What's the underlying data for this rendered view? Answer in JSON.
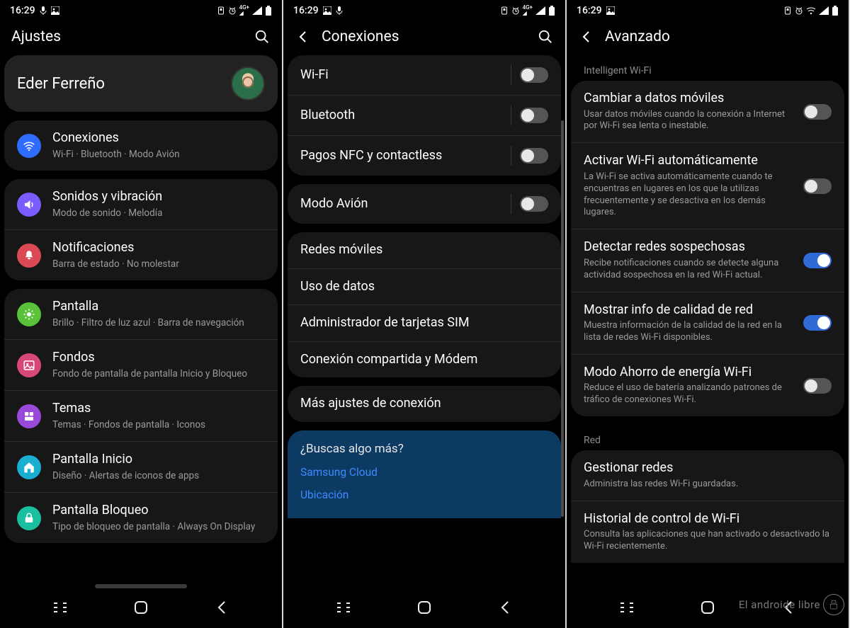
{
  "status": {
    "time": "16:29",
    "icons_left": [
      "mic",
      "image"
    ],
    "icons_right": [
      "dnd",
      "alarm",
      "4g",
      "signal",
      "battery"
    ]
  },
  "screen1": {
    "title": "Ajustes",
    "profile_name": "Eder Ferreño",
    "groups": [
      {
        "rows": [
          {
            "icon": "wifi",
            "color": "ic-blue",
            "title": "Conexiones",
            "sub": "Wi-Fi  ·  Bluetooth  ·  Modo Avión"
          }
        ]
      },
      {
        "rows": [
          {
            "icon": "sound",
            "color": "ic-purple",
            "title": "Sonidos y vibración",
            "sub": "Modo de sonido  ·  Melodía"
          },
          {
            "icon": "bell",
            "color": "ic-red",
            "title": "Notificaciones",
            "sub": "Barra de estado  ·  No molestar"
          }
        ]
      },
      {
        "rows": [
          {
            "icon": "sun",
            "color": "ic-green",
            "title": "Pantalla",
            "sub": "Brillo  ·  Filtro de luz azul  ·  Barra de navegación"
          },
          {
            "icon": "image",
            "color": "ic-pink",
            "title": "Fondos",
            "sub": "Fondo de pantalla de pantalla Inicio y Bloqueo"
          },
          {
            "icon": "palette",
            "color": "ic-violet",
            "title": "Temas",
            "sub": "Temas  ·  Fondos de pantalla  ·  Iconos"
          },
          {
            "icon": "home",
            "color": "ic-teal",
            "title": "Pantalla Inicio",
            "sub": "Diseño  ·  Alertas de iconos de apps"
          },
          {
            "icon": "lock",
            "color": "ic-teal2",
            "title": "Pantalla Bloqueo",
            "sub": "Tipo de bloqueo de pantalla  ·  Always On Display"
          }
        ]
      }
    ]
  },
  "screen2": {
    "title": "Conexiones",
    "group1": [
      {
        "title": "Wi-Fi",
        "toggle": false
      },
      {
        "title": "Bluetooth",
        "toggle": false
      },
      {
        "title": "Pagos NFC y contactless",
        "toggle": false
      }
    ],
    "group2": [
      {
        "title": "Modo Avión",
        "toggle": false
      }
    ],
    "group3": [
      {
        "title": "Redes móviles"
      },
      {
        "title": "Uso de datos"
      },
      {
        "title": "Administrador de tarjetas SIM"
      },
      {
        "title": "Conexión compartida y Módem"
      }
    ],
    "group4": [
      {
        "title": "Más ajustes de conexión"
      }
    ],
    "suggest": {
      "question": "¿Buscas algo más?",
      "links": [
        "Samsung Cloud",
        "Ubicación"
      ]
    }
  },
  "screen3": {
    "title": "Avanzado",
    "section1_header": "Intelligent Wi-Fi",
    "section1": [
      {
        "title": "Cambiar a datos móviles",
        "sub": "Usar datos móviles cuando la conexión a Internet por Wi-Fi sea lenta o inestable.",
        "toggle": false
      },
      {
        "title": "Activar Wi-Fi automáticamente",
        "sub": "La Wi-Fi se activa automáticamente cuando te encuentras en lugares en los que la utilizas frecuentemente y se desactiva en los demás lugares.",
        "toggle": false
      },
      {
        "title": "Detectar redes sospechosas",
        "sub": "Recibe notificaciones cuando se detecte alguna actividad sospechosa en la red Wi-Fi actual.",
        "toggle": true
      },
      {
        "title": "Mostrar info de calidad de red",
        "sub": "Muestra información de la calidad de la red en la lista de redes Wi-Fi disponibles.",
        "toggle": true
      },
      {
        "title": "Modo Ahorro de energía Wi-Fi",
        "sub": "Reduce el uso de batería analizando patrones de tráfico de conexiones Wi-Fi.",
        "toggle": false
      }
    ],
    "section2_header": "Red",
    "section2": [
      {
        "title": "Gestionar redes",
        "sub": "Administra las redes Wi-Fi guardadas."
      },
      {
        "title": "Historial de control de Wi-Fi",
        "sub": "Consulta las aplicaciones que han activado o desactivado la Wi-Fi recientemente."
      }
    ]
  },
  "watermark": "El androide libre"
}
